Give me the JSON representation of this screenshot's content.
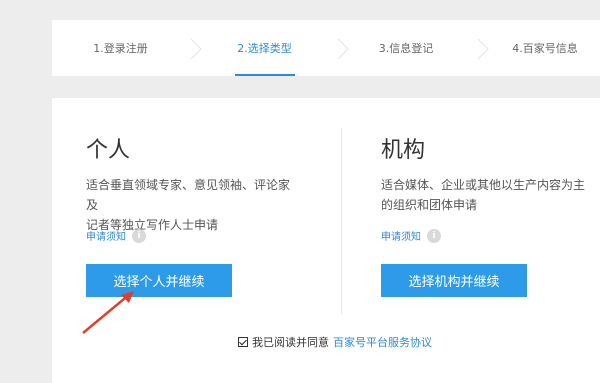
{
  "steps": [
    {
      "label": "1.登录注册",
      "active": false
    },
    {
      "label": "2.选择类型",
      "active": true
    },
    {
      "label": "3.信息登记",
      "active": false
    },
    {
      "label": "4.百家号信息",
      "active": false
    }
  ],
  "personal": {
    "title": "个人",
    "desc_line1": "适合垂直领域专家、意见领袖、评论家及",
    "desc_line2": "记者等独立写作人士申请",
    "notice": "申请须知",
    "button": "选择个人并继续"
  },
  "organization": {
    "title": "机构",
    "desc_line1": "适合媒体、企业或其他以生产内容为主",
    "desc_line2": "的组织和团体申请",
    "notice": "申请须知",
    "button": "选择机构并继续"
  },
  "agreement": {
    "checked": true,
    "prefix": "我已阅读并同意",
    "link": "百家号平台服务协议"
  },
  "info_icon_glyph": "i",
  "colors": {
    "accent": "#2f89dc",
    "button": "#2d9be8",
    "arrow": "#e0402a"
  }
}
